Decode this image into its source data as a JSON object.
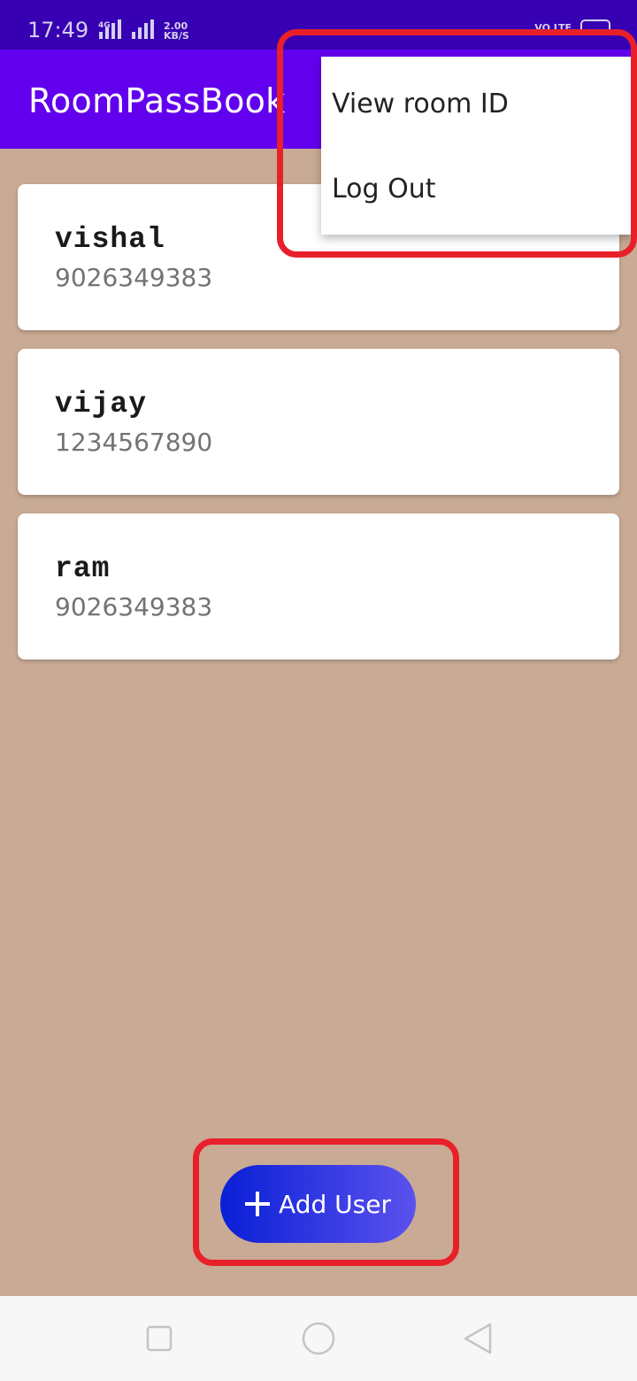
{
  "status_bar": {
    "time": "17:49",
    "network_type": "4G",
    "net_speed_value": "2.00",
    "net_speed_unit": "KB/S",
    "volte": "VO LTE",
    "icons": [
      "signal-icon",
      "battery-icon"
    ]
  },
  "app_bar": {
    "title": "RoomPassBook"
  },
  "users": [
    {
      "name": "vishal",
      "phone": "9026349383"
    },
    {
      "name": "vijay",
      "phone": "1234567890"
    },
    {
      "name": "ram",
      "phone": "9026349383"
    }
  ],
  "overflow_menu": {
    "items": [
      {
        "label": "View room ID"
      },
      {
        "label": "Log Out"
      }
    ]
  },
  "fab": {
    "label": "Add User",
    "icon": "plus-icon"
  },
  "nav_bar": {
    "icons": [
      "recents-square-icon",
      "home-circle-icon",
      "back-triangle-icon"
    ]
  },
  "colors": {
    "status_bar": "#3700b3",
    "app_bar": "#6200ee",
    "background": "#c9aa94",
    "highlight": "#e8202a",
    "fab_gradient_start": "#0a1fd6",
    "fab_gradient_end": "#5b52ee"
  }
}
